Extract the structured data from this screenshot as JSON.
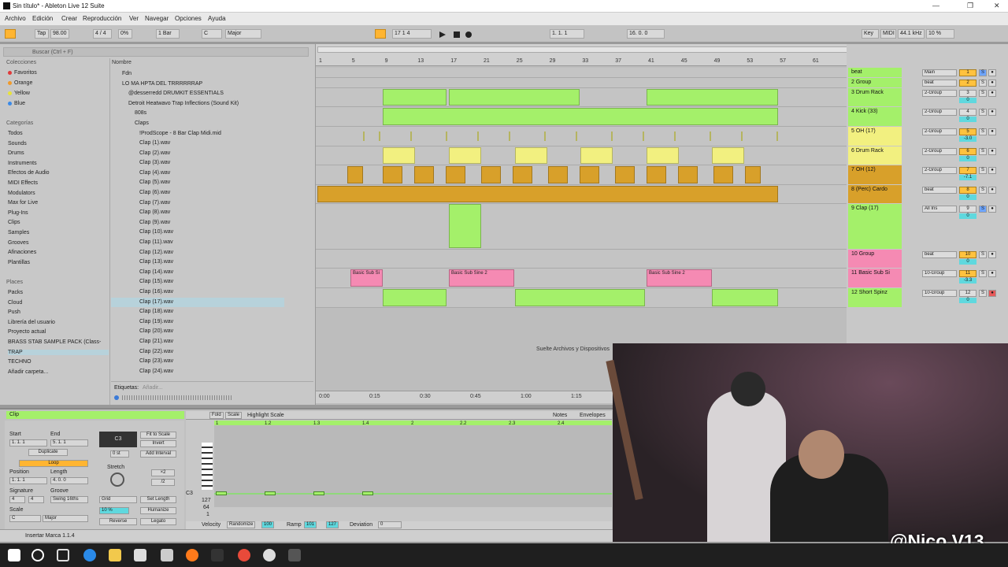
{
  "window": {
    "title": "Sin título* - Ableton Live 12 Suite",
    "min": "—",
    "max": "❐",
    "close": "✕"
  },
  "menu": [
    "Archivo",
    "Edición",
    "Crear",
    "Reproducción",
    "Ver",
    "Navegar",
    "Opciones",
    "Ayuda"
  ],
  "control": {
    "tap": "Tap",
    "tempo": "98.00",
    "signature": "4 / 4",
    "swing": "0%",
    "quant": "1 Bar",
    "key": "C",
    "scale": "Major",
    "position": "17   1   4",
    "loop_start": "1.  1.  1",
    "loop_len": "16.  0.  0",
    "key_btn": "Key",
    "midi_btn": "MIDI",
    "sample_rate": "44.1 kHz",
    "cpu": "10 %"
  },
  "browser": {
    "search_placeholder": "Buscar (Ctrl + F)",
    "collections_header": "Colecciones",
    "collections": [
      {
        "label": "Favoritos",
        "color": "#e03a3a"
      },
      {
        "label": "Orange",
        "color": "#f09a2a"
      },
      {
        "label": "Yellow",
        "color": "#e8e23a"
      },
      {
        "label": "Blue",
        "color": "#3a8ae8"
      }
    ],
    "categories_header": "Categorías",
    "categories": [
      "Todos",
      "Sounds",
      "Drums",
      "Instruments",
      "Efectos de Audio",
      "MIDI Effects",
      "Modulators",
      "Max for Live",
      "Plug-Ins",
      "Clips",
      "Samples",
      "Grooves",
      "Afinaciones",
      "Plantillas"
    ],
    "places_header": "Places",
    "places": [
      "Packs",
      "Cloud",
      "Push",
      "Librería del usuario",
      "Proyecto actual",
      "BRASS STAB SAMPLE PACK (Class-",
      "TRAP",
      "TECHNO",
      "Añadir carpeta..."
    ],
    "name_header": "Nombre",
    "tree": [
      "Fdn",
      "LO MA HPTA DEL TRRRRRRAP",
      "@desserredd DRUMKIT ESSENTIALS",
      "Detroit Heatwavo Trap Inflections (Sound Kit)",
      "808s",
      "Claps",
      "!ProdScope - 8 Bar Clap Midi.mid"
    ],
    "files": [
      "Clap (1).wav",
      "Clap (2).wav",
      "Clap (3).wav",
      "Clap (4).wav",
      "Clap (5).wav",
      "Clap (6).wav",
      "Clap (7).wav",
      "Clap (8).wav",
      "Clap (9).wav",
      "Clap (10).wav",
      "Clap (11).wav",
      "Clap (12).wav",
      "Clap (13).wav",
      "Clap (14).wav",
      "Clap (15).wav",
      "Clap (16).wav",
      "Clap (17).wav",
      "Clap (18).wav",
      "Clap (19).wav",
      "Clap (20).wav",
      "Clap (21).wav",
      "Clap (22).wav",
      "Clap (23).wav",
      "Clap (24).wav"
    ],
    "selected_index": 16,
    "tags_label": "Etiquetas:",
    "tags_placeholder": "Añadir..."
  },
  "ruler": {
    "bars": [
      "1",
      "5",
      "9",
      "13",
      "17",
      "21",
      "25",
      "29",
      "33",
      "37",
      "41",
      "45",
      "49",
      "53",
      "57",
      "61"
    ],
    "times": [
      "0:00",
      "0:15",
      "0:30",
      "0:45",
      "1:00",
      "1:15"
    ],
    "hint": "Suelte Archivos y Dispositivos"
  },
  "tracks": [
    {
      "name": "beat",
      "color": "g",
      "io": "Main",
      "num": "1",
      "vol": "0"
    },
    {
      "name": "2 Group",
      "color": "g",
      "io": "beat",
      "num": "2",
      "vol": "0"
    },
    {
      "name": "3 Drum Rack",
      "color": "g",
      "io": "2-Group",
      "num": "3",
      "vol": "0"
    },
    {
      "name": "4 Kick (33)",
      "color": "g",
      "io": "2-Group",
      "num": "4",
      "vol": "0"
    },
    {
      "name": "5 OH (17)",
      "color": "y",
      "io": "2-Group",
      "num": "5",
      "vol": "-3.0"
    },
    {
      "name": "6 Drum Rack",
      "color": "y",
      "io": "2-Group",
      "num": "6",
      "vol": "0"
    },
    {
      "name": "7 OH (12)",
      "color": "o",
      "io": "2-Group",
      "num": "7",
      "vol": "-7.1"
    },
    {
      "name": "8 (Perc) Cardo",
      "color": "o",
      "io": "beat",
      "num": "8",
      "vol": "0"
    },
    {
      "name": "9 Clap (17)",
      "color": "g",
      "io": "All Ins",
      "num": "9",
      "vol": "0"
    },
    {
      "name": "10 Group",
      "color": "p",
      "io": "beat",
      "num": "10",
      "vol": "0"
    },
    {
      "name": "11 Basic Sub Si",
      "color": "p",
      "io": "10-Group",
      "num": "11",
      "vol": "-3.3"
    },
    {
      "name": "12 Short Spinz",
      "color": "g",
      "io": "10-Group",
      "num": "12",
      "vol": "0"
    }
  ],
  "clip_names": [
    "Basic Sub Si",
    "Basic Sub Sine 2",
    "Basic Sub Sine 2"
  ],
  "clipview": {
    "title": "Clip",
    "start": "Start",
    "end": "End",
    "dup": "Duplicate",
    "loop": "Loop",
    "position": "Position",
    "length": "Length",
    "signature": "Signature",
    "groove": "Groove",
    "scale_lbl": "Scale",
    "start_val": "1.  1.  1",
    "end_val": "5.  1.  1",
    "pos_val": "1.  1.  1",
    "len_val": "4.  0.  0",
    "sig_num": "4",
    "sig_den": "4",
    "groove_val": "Swing 16ths",
    "scale_key": "C",
    "scale_mode": "Major",
    "note": "C3",
    "fit": "Fit to Scale",
    "invert": "Invert",
    "add_int": "Add Interval",
    "zero": "0 st",
    "stretch": "Stretch",
    "x2": "×2",
    "div2": "/2",
    "grid": "Grid",
    "set_len": "Set Length",
    "pct": "10 %",
    "humanize": "Humanize",
    "reverse": "Reverse",
    "legato": "Legato",
    "fold": "Fold",
    "scale_btn": "Scale",
    "highlight": "Highlight Scale",
    "notes_tab": "Notes",
    "env_tab": "Envelopes",
    "bar_marks": [
      "1",
      "1.2",
      "1.3",
      "1.4",
      "2",
      "2.2",
      "2.3",
      "2.4"
    ],
    "velocity": "Velocity",
    "randomize": "Randomize",
    "vel_val": "100",
    "ramp": "Ramp",
    "ramp_a": "101",
    "ramp_b": "127",
    "deviation": "Deviation",
    "dev_val": "0",
    "c3": "C3",
    "v127": "127",
    "v64": "64",
    "v1": "1"
  },
  "status": "Insertar Marca 1.1.4",
  "watermark": "@Nico.V13"
}
